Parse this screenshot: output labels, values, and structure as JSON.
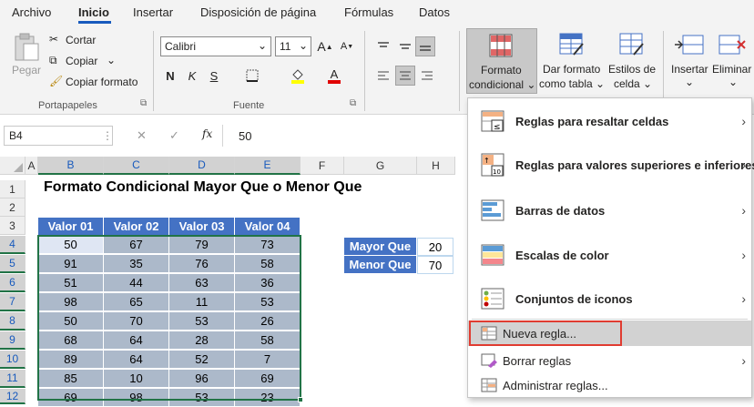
{
  "tabs": [
    "Archivo",
    "Inicio",
    "Insertar",
    "Disposición de página",
    "Fórmulas",
    "Datos"
  ],
  "ribbon": {
    "paste": "Pegar",
    "cut": "Cortar",
    "copy": "Copiar",
    "format_painter": "Copiar formato",
    "grp_clipboard": "Portapapeles",
    "font_name": "Calibri",
    "font_size": "11",
    "bold": "N",
    "italic": "K",
    "underline": "S",
    "font_color_letter": "A",
    "grow": "A",
    "shrink": "A",
    "grp_font": "Fuente",
    "cond_format": [
      "Formato",
      "condicional ⌄"
    ],
    "format_table": [
      "Dar formato",
      "como tabla ⌄"
    ],
    "cell_styles": [
      "Estilos de",
      "celda ⌄"
    ],
    "insert": [
      "Insertar",
      "⌄"
    ],
    "delete": [
      "Eliminar",
      "⌄"
    ]
  },
  "formula_bar": {
    "name_box": "B4",
    "cancel": "✕",
    "enter": "✓",
    "fx": "fx",
    "value": "50"
  },
  "columns": [
    "A",
    "B",
    "C",
    "D",
    "E",
    "F",
    "G",
    "H"
  ],
  "rows": [
    "1",
    "2",
    "3",
    "4",
    "5",
    "6",
    "7",
    "8",
    "9",
    "10",
    "11",
    "12"
  ],
  "sheet": {
    "title": "Formato Condicional Mayor Que o Menor Que",
    "headers": [
      "Valor 01",
      "Valor 02",
      "Valor 03",
      "Valor 04"
    ],
    "data": [
      [
        "50",
        "67",
        "79",
        "73"
      ],
      [
        "91",
        "35",
        "76",
        "58"
      ],
      [
        "51",
        "44",
        "63",
        "36"
      ],
      [
        "98",
        "65",
        "11",
        "53"
      ],
      [
        "50",
        "70",
        "53",
        "26"
      ],
      [
        "68",
        "64",
        "28",
        "58"
      ],
      [
        "89",
        "64",
        "52",
        "7"
      ],
      [
        "85",
        "10",
        "96",
        "69"
      ],
      [
        "69",
        "98",
        "53",
        "23"
      ]
    ],
    "side": [
      {
        "label": "Mayor Que",
        "value": "20"
      },
      {
        "label": "Menor Que",
        "value": "70"
      }
    ]
  },
  "menu": {
    "items": [
      "Reglas para resaltar celdas",
      "Reglas para valores superiores e inferiores",
      "Barras de datos",
      "Escalas de color",
      "Conjuntos de iconos"
    ],
    "new_rule": "Nueva regla...",
    "clear_rules": "Borrar reglas",
    "manage_rules": "Administrar reglas..."
  },
  "colors": {
    "header_blue": "#4472c4",
    "cell_gray": "#acb9ca",
    "active_tab": "#185abd",
    "highlight_red": "#e03c31"
  }
}
